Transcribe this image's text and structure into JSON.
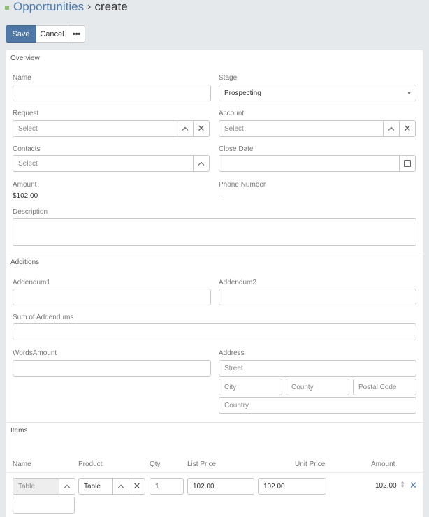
{
  "breadcrumb": {
    "parent": "Opportunities",
    "separator": "›",
    "current": "create"
  },
  "toolbar": {
    "save_label": "Save",
    "cancel_label": "Cancel",
    "more_label": "•••"
  },
  "overview": {
    "title": "Overview",
    "name": {
      "label": "Name",
      "value": ""
    },
    "stage": {
      "label": "Stage",
      "value": "Prospecting"
    },
    "request": {
      "label": "Request",
      "placeholder": "Select"
    },
    "account": {
      "label": "Account",
      "placeholder": "Select"
    },
    "contacts": {
      "label": "Contacts",
      "placeholder": "Select"
    },
    "close_date": {
      "label": "Close Date",
      "value": ""
    },
    "amount": {
      "label": "Amount",
      "value": "$102.00"
    },
    "phone": {
      "label": "Phone Number",
      "value": "–"
    },
    "description": {
      "label": "Description",
      "value": ""
    }
  },
  "additions": {
    "title": "Additions",
    "addendum1": {
      "label": "Addendum1",
      "value": ""
    },
    "addendum2": {
      "label": "Addendum2",
      "value": ""
    },
    "sum": {
      "label": "Sum of Addendums",
      "value": ""
    },
    "words_amount": {
      "label": "WordsAmount",
      "value": ""
    },
    "address": {
      "label": "Address",
      "street": "Street",
      "city": "City",
      "county": "County",
      "postal": "Postal Code",
      "country": "Country"
    }
  },
  "items": {
    "title": "Items",
    "columns": {
      "name": "Name",
      "product": "Product",
      "qty": "Qty",
      "list_price": "List Price",
      "unit_price": "Unit Price",
      "amount": "Amount"
    },
    "rows": [
      {
        "name": "Table",
        "product": "Table",
        "qty": "1",
        "list_price": "102.00",
        "unit_price": "102.00",
        "amount": "102.00"
      }
    ]
  },
  "icons": {
    "calendar": "calendar-icon",
    "up": "chevron-up-icon",
    "clear": "close-icon",
    "drag": "drag-handle-icon"
  },
  "colors": {
    "primary": "#4f77a6",
    "link": "#4e7bad",
    "accent": "#8cbf6a"
  }
}
